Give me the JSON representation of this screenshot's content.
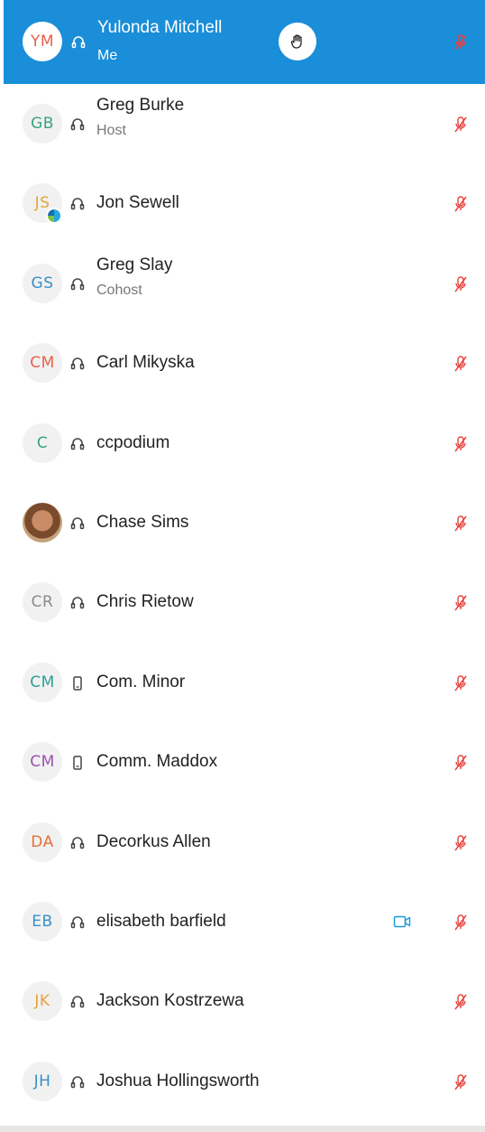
{
  "participants": [
    {
      "initials": "YM",
      "name": "Yulonda Mitchell",
      "role": "Me",
      "device": "headset-icon",
      "color": "#e8604c",
      "selected": true,
      "hand_raised": true
    },
    {
      "initials": "GB",
      "name": "Greg Burke",
      "role": "Host",
      "device": "headset-icon",
      "color": "#3aa17e"
    },
    {
      "initials": "JS",
      "name": "Jon Sewell",
      "role": "",
      "device": "headset-icon",
      "color": "#e8a23a",
      "badge": true
    },
    {
      "initials": "GS",
      "name": "Greg Slay",
      "role": "Cohost",
      "device": "headset-icon",
      "color": "#3a8fc4"
    },
    {
      "initials": "CM",
      "name": "Carl Mikyska",
      "role": "",
      "device": "headset-icon",
      "color": "#e8604c"
    },
    {
      "initials": "C",
      "name": "ccpodium",
      "role": "",
      "device": "headset-icon",
      "color": "#3aa17e"
    },
    {
      "initials": "",
      "name": "Chase Sims",
      "role": "",
      "device": "headset-icon",
      "photo": true
    },
    {
      "initials": "CR",
      "name": "Chris Rietow",
      "role": "",
      "device": "headset-icon",
      "color": "#8a8a8a"
    },
    {
      "initials": "CM",
      "name": "Com. Minor",
      "role": "",
      "device": "phone-icon",
      "color": "#2aa192"
    },
    {
      "initials": "CM",
      "name": "Comm. Maddox",
      "role": "",
      "device": "phone-icon",
      "color": "#9b4fb0"
    },
    {
      "initials": "DA",
      "name": "Decorkus Allen",
      "role": "",
      "device": "headset-icon",
      "color": "#e8703a"
    },
    {
      "initials": "EB",
      "name": "elisabeth barfield",
      "role": "",
      "device": "headset-icon",
      "color": "#3a8fc4",
      "video": true
    },
    {
      "initials": "JK",
      "name": "Jackson Kostrzewa",
      "role": "",
      "device": "headset-icon",
      "color": "#e8a23a"
    },
    {
      "initials": "JH",
      "name": "Joshua Hollingsworth",
      "role": "",
      "device": "headset-icon",
      "color": "#3a8fc4"
    }
  ],
  "colors": {
    "selected_bg": "#1a8ed8",
    "mic_muted": "#e8403a",
    "video": "#1a9bd8"
  }
}
